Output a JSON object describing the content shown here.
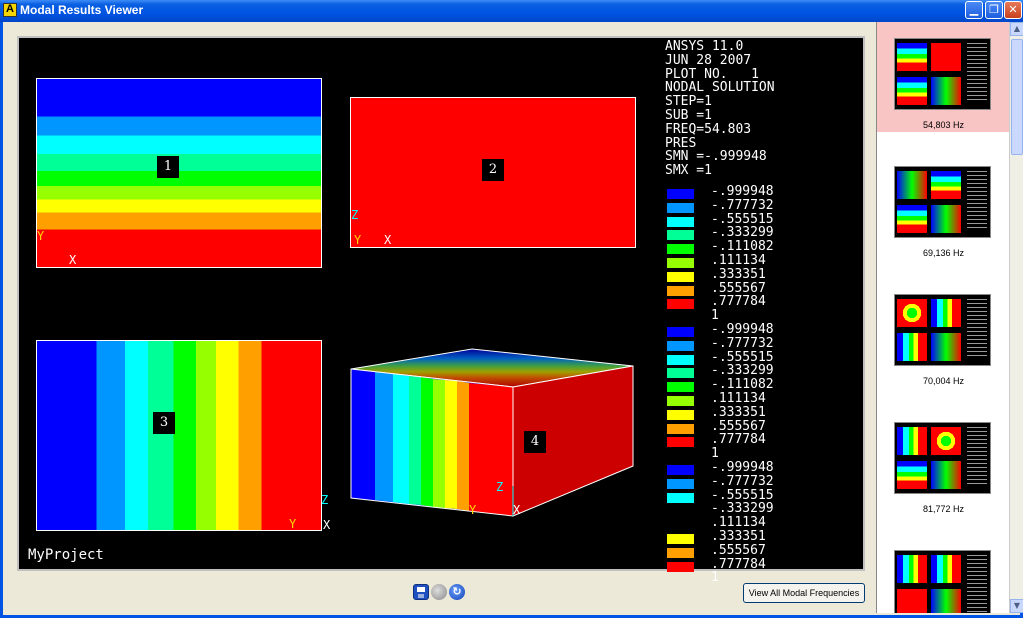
{
  "window": {
    "title": "Modal Results Viewer",
    "app_icon_letter": "A",
    "controls": [
      "minimize-icon",
      "maximize-icon",
      "close-icon"
    ]
  },
  "plot": {
    "info_lines": [
      "ANSYS 11.0",
      "JUN 28 2007",
      "PLOT NO.   1",
      "NODAL SOLUTION",
      "STEP=1",
      "SUB =1",
      "FREQ=54.803",
      "PRES",
      "SMN =-.999948",
      "SMX =1"
    ],
    "legend_values": [
      "-.999948",
      "-.777732",
      "-.555515",
      "-.333299",
      "-.111082",
      ".111134",
      ".333351",
      ".555567",
      ".777784",
      "1"
    ],
    "legend_values_3": [
      "-.999948",
      "-.777732",
      "-.555515",
      "-.333299",
      "",
      ".333351",
      ".555567",
      ".777784",
      "1"
    ],
    "legend_colors": [
      "#0000ff",
      "#0096ff",
      "#00ffff",
      "#00ff96",
      "#00ff00",
      "#96ff00",
      "#ffff00",
      "#ffa000",
      "#ff0000"
    ],
    "quadrant_labels": [
      "1",
      "2",
      "3",
      "4"
    ],
    "axis": {
      "x": "X",
      "y": "Y",
      "z": "Z"
    },
    "project_label": "MyProject"
  },
  "sidebar": {
    "thumbnails": [
      {
        "label": "54,803 Hz",
        "selected": true
      },
      {
        "label": "69,136 Hz",
        "selected": false
      },
      {
        "label": "70,004 Hz",
        "selected": false
      },
      {
        "label": "81,772 Hz",
        "selected": false
      },
      {
        "label": "",
        "selected": false
      }
    ]
  },
  "footer": {
    "icons": [
      "save-icon",
      "record-icon",
      "refresh-icon"
    ],
    "view_all_label": "View All Modal Frequencies"
  }
}
